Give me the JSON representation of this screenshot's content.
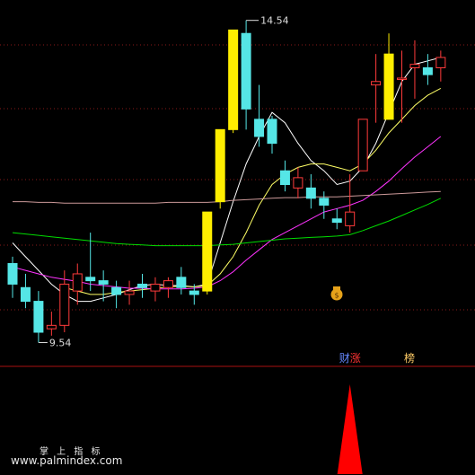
{
  "chart_data": [
    {
      "type": "candlestick",
      "annotations": {
        "high_label": "14.54",
        "low_label": "9.54"
      },
      "candles": [
        {
          "o": 11.0,
          "h": 11.1,
          "l": 10.5,
          "c": 10.7
        },
        {
          "o": 10.65,
          "h": 10.85,
          "l": 10.35,
          "c": 10.45
        },
        {
          "o": 10.45,
          "h": 10.6,
          "l": 9.85,
          "c": 10.0
        },
        {
          "o": 10.05,
          "h": 10.3,
          "l": 9.95,
          "c": 10.1
        },
        {
          "o": 10.1,
          "h": 10.9,
          "l": 10.0,
          "c": 10.7
        },
        {
          "o": 10.6,
          "h": 11.0,
          "l": 10.4,
          "c": 10.85
        },
        {
          "o": 10.8,
          "h": 11.45,
          "l": 10.6,
          "c": 10.75
        },
        {
          "o": 10.75,
          "h": 10.9,
          "l": 10.45,
          "c": 10.7
        },
        {
          "o": 10.65,
          "h": 10.75,
          "l": 10.35,
          "c": 10.55
        },
        {
          "o": 10.55,
          "h": 10.75,
          "l": 10.4,
          "c": 10.6
        },
        {
          "o": 10.7,
          "h": 10.85,
          "l": 10.5,
          "c": 10.65
        },
        {
          "o": 10.6,
          "h": 10.8,
          "l": 10.45,
          "c": 10.7
        },
        {
          "o": 10.65,
          "h": 10.8,
          "l": 10.5,
          "c": 10.75
        },
        {
          "o": 10.8,
          "h": 10.95,
          "l": 10.55,
          "c": 10.65
        },
        {
          "o": 10.6,
          "h": 10.7,
          "l": 10.4,
          "c": 10.55
        },
        {
          "o": 10.6,
          "h": 11.75,
          "l": 10.55,
          "c": 11.75
        },
        {
          "o": 11.9,
          "h": 12.95,
          "l": 11.8,
          "c": 12.95
        },
        {
          "o": 12.95,
          "h": 14.4,
          "l": 12.9,
          "c": 14.4
        },
        {
          "o": 14.35,
          "h": 14.54,
          "l": 12.95,
          "c": 13.25
        },
        {
          "o": 13.1,
          "h": 13.6,
          "l": 12.7,
          "c": 12.85
        },
        {
          "o": 13.1,
          "h": 13.15,
          "l": 12.6,
          "c": 12.75
        },
        {
          "o": 12.35,
          "h": 12.5,
          "l": 12.05,
          "c": 12.15
        },
        {
          "o": 12.1,
          "h": 12.4,
          "l": 11.95,
          "c": 12.25
        },
        {
          "o": 12.1,
          "h": 12.3,
          "l": 11.8,
          "c": 11.95
        },
        {
          "o": 11.95,
          "h": 12.05,
          "l": 11.65,
          "c": 11.85
        },
        {
          "o": 11.65,
          "h": 11.8,
          "l": 11.5,
          "c": 11.6
        },
        {
          "o": 11.55,
          "h": 12.3,
          "l": 11.45,
          "c": 11.75
        },
        {
          "o": 12.35,
          "h": 13.1,
          "l": 12.35,
          "c": 13.1
        },
        {
          "o": 13.6,
          "h": 14.05,
          "l": 13.05,
          "c": 13.65
        },
        {
          "o": 13.1,
          "h": 14.35,
          "l": 13.2,
          "c": 14.05
        },
        {
          "o": 13.7,
          "h": 14.1,
          "l": 13.05,
          "c": 13.7
        },
        {
          "o": 13.85,
          "h": 14.25,
          "l": 13.4,
          "c": 13.9
        },
        {
          "o": 13.85,
          "h": 14.05,
          "l": 13.6,
          "c": 13.75
        },
        {
          "o": 13.85,
          "h": 14.1,
          "l": 13.65,
          "c": 14.0
        }
      ],
      "moving_averages": [
        {
          "color": "#ffffff",
          "values": [
            11.3,
            11.1,
            10.9,
            10.7,
            10.55,
            10.45,
            10.45,
            10.5,
            10.55,
            10.62,
            10.68,
            10.7,
            10.68,
            10.68,
            10.66,
            10.7,
            11.3,
            11.9,
            12.45,
            12.85,
            13.2,
            13.05,
            12.75,
            12.5,
            12.35,
            12.15,
            12.2,
            12.4,
            12.75,
            13.2,
            13.65,
            13.9,
            13.95,
            14.0
          ]
        },
        {
          "color": "#ffff66",
          "values": [
            null,
            null,
            null,
            null,
            10.65,
            10.6,
            10.55,
            10.55,
            10.58,
            10.6,
            10.62,
            10.64,
            10.66,
            10.67,
            10.66,
            10.68,
            10.85,
            11.1,
            11.45,
            11.85,
            12.15,
            12.3,
            12.4,
            12.45,
            12.45,
            12.4,
            12.35,
            12.45,
            12.65,
            12.9,
            13.1,
            13.3,
            13.45,
            13.55
          ]
        },
        {
          "color": "#ff33ff",
          "values": [
            10.95,
            10.9,
            10.85,
            10.8,
            10.77,
            10.74,
            10.7,
            10.68,
            10.66,
            10.64,
            10.64,
            10.63,
            10.63,
            10.63,
            10.64,
            10.66,
            10.75,
            10.88,
            11.05,
            11.2,
            11.35,
            11.45,
            11.55,
            11.65,
            11.75,
            11.8,
            11.85,
            11.92,
            12.05,
            12.2,
            12.38,
            12.55,
            12.7,
            12.85
          ]
        },
        {
          "color": "#00dd00",
          "values": [
            11.45,
            11.43,
            11.41,
            11.39,
            11.37,
            11.35,
            11.33,
            11.31,
            11.29,
            11.28,
            11.27,
            11.26,
            11.26,
            11.26,
            11.26,
            11.26,
            11.27,
            11.28,
            11.3,
            11.32,
            11.34,
            11.36,
            11.37,
            11.38,
            11.39,
            11.4,
            11.42,
            11.48,
            11.55,
            11.62,
            11.7,
            11.78,
            11.86,
            11.95
          ]
        },
        {
          "color": "#cc9999",
          "values": [
            11.9,
            11.9,
            11.89,
            11.89,
            11.88,
            11.88,
            11.88,
            11.88,
            11.88,
            11.88,
            11.88,
            11.88,
            11.89,
            11.89,
            11.89,
            11.89,
            11.9,
            11.92,
            11.93,
            11.94,
            11.95,
            11.96,
            11.96,
            11.97,
            11.97,
            11.97,
            11.98,
            11.99,
            12.0,
            12.01,
            12.02,
            12.03,
            12.04,
            12.05
          ]
        }
      ],
      "markers": [
        {
          "index": 26,
          "label": "财",
          "color": "#6688ff"
        },
        {
          "index": 26,
          "label": "涨",
          "color": "#ff3333"
        },
        {
          "index": 31,
          "label": "榜",
          "color": "#ffcc66"
        }
      ]
    },
    {
      "type": "bar",
      "spike": {
        "index": 26,
        "value": 1.0,
        "color": "#ff0000"
      }
    }
  ],
  "watermark": {
    "line1": "掌 上 指 标",
    "line2": "www.palmindex.com"
  }
}
